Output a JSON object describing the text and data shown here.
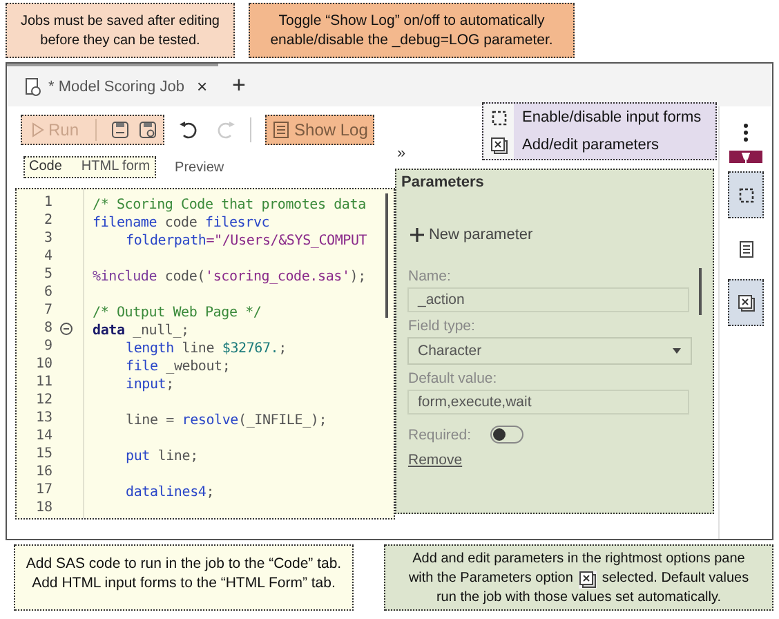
{
  "top_callouts": [
    {
      "lines": [
        {
          "text": "Jobs must be saved after editing"
        },
        {
          "text": "before they can be tested."
        }
      ],
      "color": "#f8d9c4"
    },
    {
      "lines": [
        {
          "text": "Toggle “Show Log” on/off to automatically"
        },
        {
          "text": "enable/disable the _debug=LOG parameter."
        }
      ],
      "color": "#f3b88d"
    }
  ],
  "window": {
    "tab": {
      "label": "* Model Scoring Job",
      "close": "×"
    },
    "new_tab": "+",
    "toolbar": {
      "run": {
        "label": "Run",
        "disabled": true
      },
      "show_log": {
        "label": "Show Log",
        "disabled": false
      },
      "redo_disabled": true
    },
    "editor_tabs": [
      {
        "label": "Code",
        "selected": true
      },
      {
        "label": "HTML form",
        "selected": false
      },
      {
        "label": "Preview",
        "selected": false
      }
    ],
    "collapse": "»",
    "code_lines": [
      {
        "no": "1",
        "tokens": [
          {
            "kind": "comment",
            "text": "/* Scoring Code that promotes data"
          }
        ]
      },
      {
        "no": "2",
        "tokens": [
          {
            "kind": "keyword",
            "text": "filename"
          },
          {
            "kind": "plain",
            "text": " code "
          },
          {
            "kind": "keyword",
            "text": "filesrvc"
          }
        ]
      },
      {
        "no": "3",
        "indent": true,
        "tokens": [
          {
            "kind": "keyword",
            "text": "folderpath"
          },
          {
            "kind": "string",
            "text": "=\"/Users/&SYS_COMPUT"
          }
        ]
      },
      {
        "no": "4"
      },
      {
        "no": "5",
        "tokens": [
          {
            "kind": "macro",
            "text": "%include"
          },
          {
            "kind": "plain",
            "text": " code("
          },
          {
            "kind": "string",
            "text": "'scoring_code.sas'"
          },
          {
            "kind": "plain",
            "text": ");"
          }
        ]
      },
      {
        "no": "6"
      },
      {
        "no": "7",
        "tokens": [
          {
            "kind": "comment",
            "text": "/* Output Web Page */"
          }
        ]
      },
      {
        "no": "8",
        "fold": true,
        "tokens": [
          {
            "kind": "step",
            "text": "data"
          },
          {
            "kind": "plain",
            "text": " _null_;"
          }
        ]
      },
      {
        "no": "9",
        "indent": true,
        "tokens": [
          {
            "kind": "keyword",
            "text": "length"
          },
          {
            "kind": "plain",
            "text": " line "
          },
          {
            "kind": "number",
            "text": "$32767."
          },
          {
            "kind": "plain",
            "text": ";"
          }
        ]
      },
      {
        "no": "10",
        "indent": true,
        "tokens": [
          {
            "kind": "keyword",
            "text": "file"
          },
          {
            "kind": "plain",
            "text": " _webout;"
          }
        ]
      },
      {
        "no": "11",
        "indent": true,
        "tokens": [
          {
            "kind": "keyword",
            "text": "input"
          },
          {
            "kind": "plain",
            "text": ";"
          }
        ]
      },
      {
        "no": "12"
      },
      {
        "no": "13",
        "indent": true,
        "tokens": [
          {
            "kind": "plain",
            "text": "line = "
          },
          {
            "kind": "keyword",
            "text": "resolve"
          },
          {
            "kind": "plain",
            "text": "(_INFILE_);"
          }
        ]
      },
      {
        "no": "14"
      },
      {
        "no": "15",
        "indent": true,
        "tokens": [
          {
            "kind": "keyword",
            "text": "put"
          },
          {
            "kind": "plain",
            "text": " line;"
          }
        ]
      },
      {
        "no": "16"
      },
      {
        "no": "17",
        "indent": true,
        "tokens": [
          {
            "kind": "keyword",
            "text": "datalines4"
          },
          {
            "kind": "plain",
            "text": ";"
          }
        ]
      },
      {
        "no": "18"
      }
    ],
    "parameters": {
      "title": "Parameters",
      "new_button": "New parameter",
      "name_label": "Name:",
      "name_value": "_action",
      "type_label": "Field type:",
      "type_value": "Character",
      "default_label": "Default value:",
      "default_value": "form,execute,wait",
      "required_label": "Required:",
      "required": false,
      "remove": "Remove"
    },
    "rail": [
      {
        "kind": "forms",
        "highlighted": true
      },
      {
        "kind": "document",
        "highlighted": false
      },
      {
        "kind": "parameters",
        "highlighted": true
      }
    ],
    "legend": [
      {
        "kind": "forms",
        "text": "Enable/disable input forms"
      },
      {
        "kind": "parameters",
        "text": "Add/edit parameters"
      }
    ]
  },
  "bottom_callouts": [
    {
      "lines": [
        {
          "text": "Add SAS code to run in the job to the “Code” tab."
        },
        {
          "text": "Add HTML input forms to the “HTML Form” tab."
        }
      ],
      "color": "#fdfde8"
    },
    {
      "lines": [
        {
          "text": "Add and edit parameters in the rightmost options pane"
        },
        {
          "text": "with the Parameters option",
          "text_after": "selected. Default values"
        },
        {
          "text": "run the job with those values set automatically."
        }
      ],
      "color": "#dde5cf"
    }
  ]
}
